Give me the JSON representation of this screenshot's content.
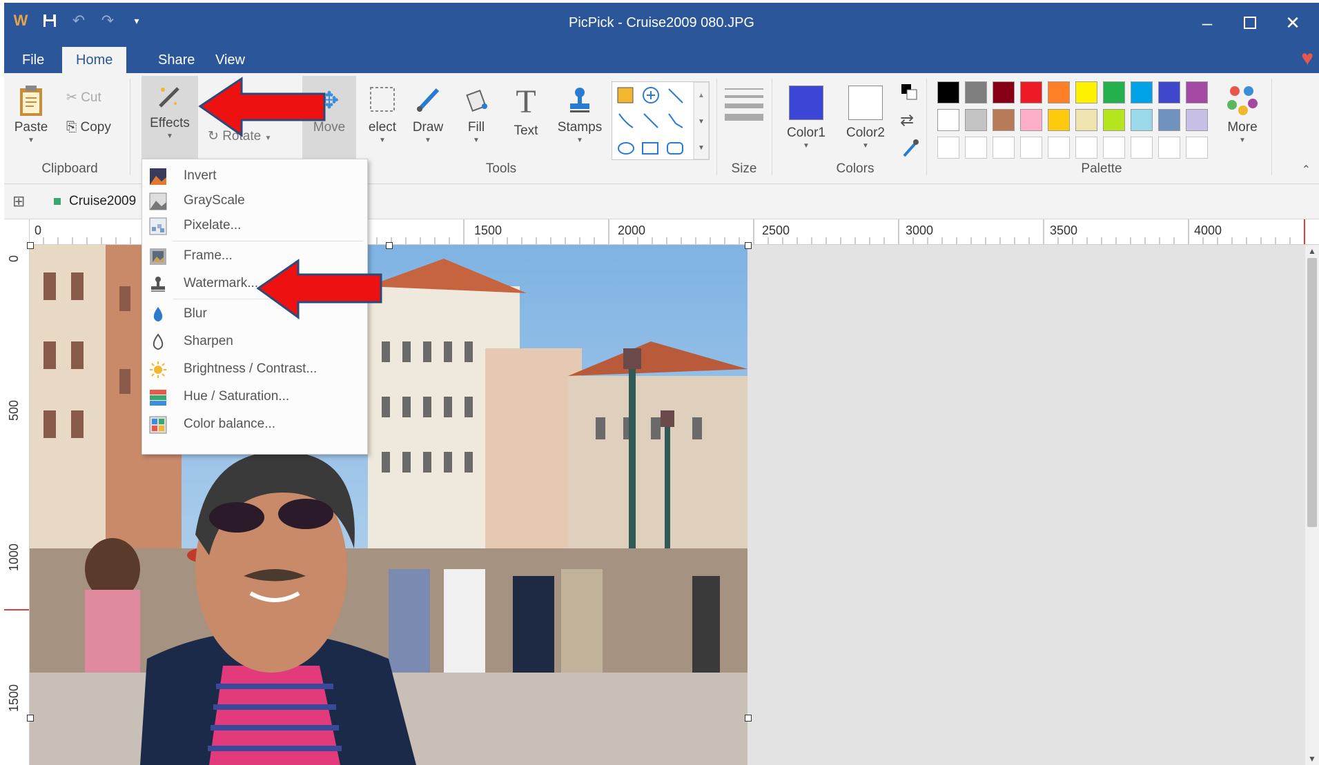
{
  "window": {
    "title": "PicPick - Cruise2009 080.JPG"
  },
  "tabs": [
    {
      "label": "File",
      "active": false
    },
    {
      "label": "Home",
      "active": true
    },
    {
      "label": "Share",
      "active": false
    },
    {
      "label": "View",
      "active": false
    }
  ],
  "clipboard": {
    "paste": "Paste",
    "cut": "Cut",
    "copy": "Copy",
    "group": "Clipboard"
  },
  "tools": {
    "effects": "Effects",
    "rotate": "Rotate",
    "move": "Move",
    "select": "elect",
    "draw": "Draw",
    "fill": "Fill",
    "text": "Text",
    "stamps": "Stamps",
    "group": "Tools"
  },
  "size": {
    "group": "Size"
  },
  "colors": {
    "color1": "Color1",
    "color2": "Color2",
    "group": "Colors",
    "color1_value": "#3b45d6",
    "color2_value": "#ffffff"
  },
  "palette": {
    "group": "Palette",
    "more": "More",
    "row1": [
      "#000000",
      "#7f7f7f",
      "#880015",
      "#ed1c24",
      "#ff7f27",
      "#fff200",
      "#22b14c",
      "#00a2e8",
      "#3f48cc",
      "#a349a4"
    ],
    "row2": [
      "#ffffff",
      "#c3c3c3",
      "#b97a57",
      "#ffaec9",
      "#ffc90e",
      "#efe4b0",
      "#b5e61d",
      "#99d9ea",
      "#7092be",
      "#c8bfe7"
    ],
    "row3": [
      "#ffffff",
      "#ffffff",
      "#ffffff",
      "#ffffff",
      "#ffffff",
      "#ffffff",
      "#ffffff",
      "#ffffff",
      "#ffffff",
      "#ffffff"
    ]
  },
  "document": {
    "tab": "Cruise2009"
  },
  "ruler": {
    "h": [
      "0",
      "1500",
      "2000",
      "2500",
      "3000",
      "3500",
      "4000"
    ],
    "v": [
      "0",
      "500",
      "1000",
      "1500"
    ]
  },
  "effects_menu": {
    "items": [
      "Invert",
      "GrayScale",
      "Pixelate...",
      "Frame...",
      "Watermark...",
      "Blur",
      "Sharpen",
      "Brightness / Contrast...",
      "Hue / Saturation...",
      "Color balance..."
    ]
  }
}
